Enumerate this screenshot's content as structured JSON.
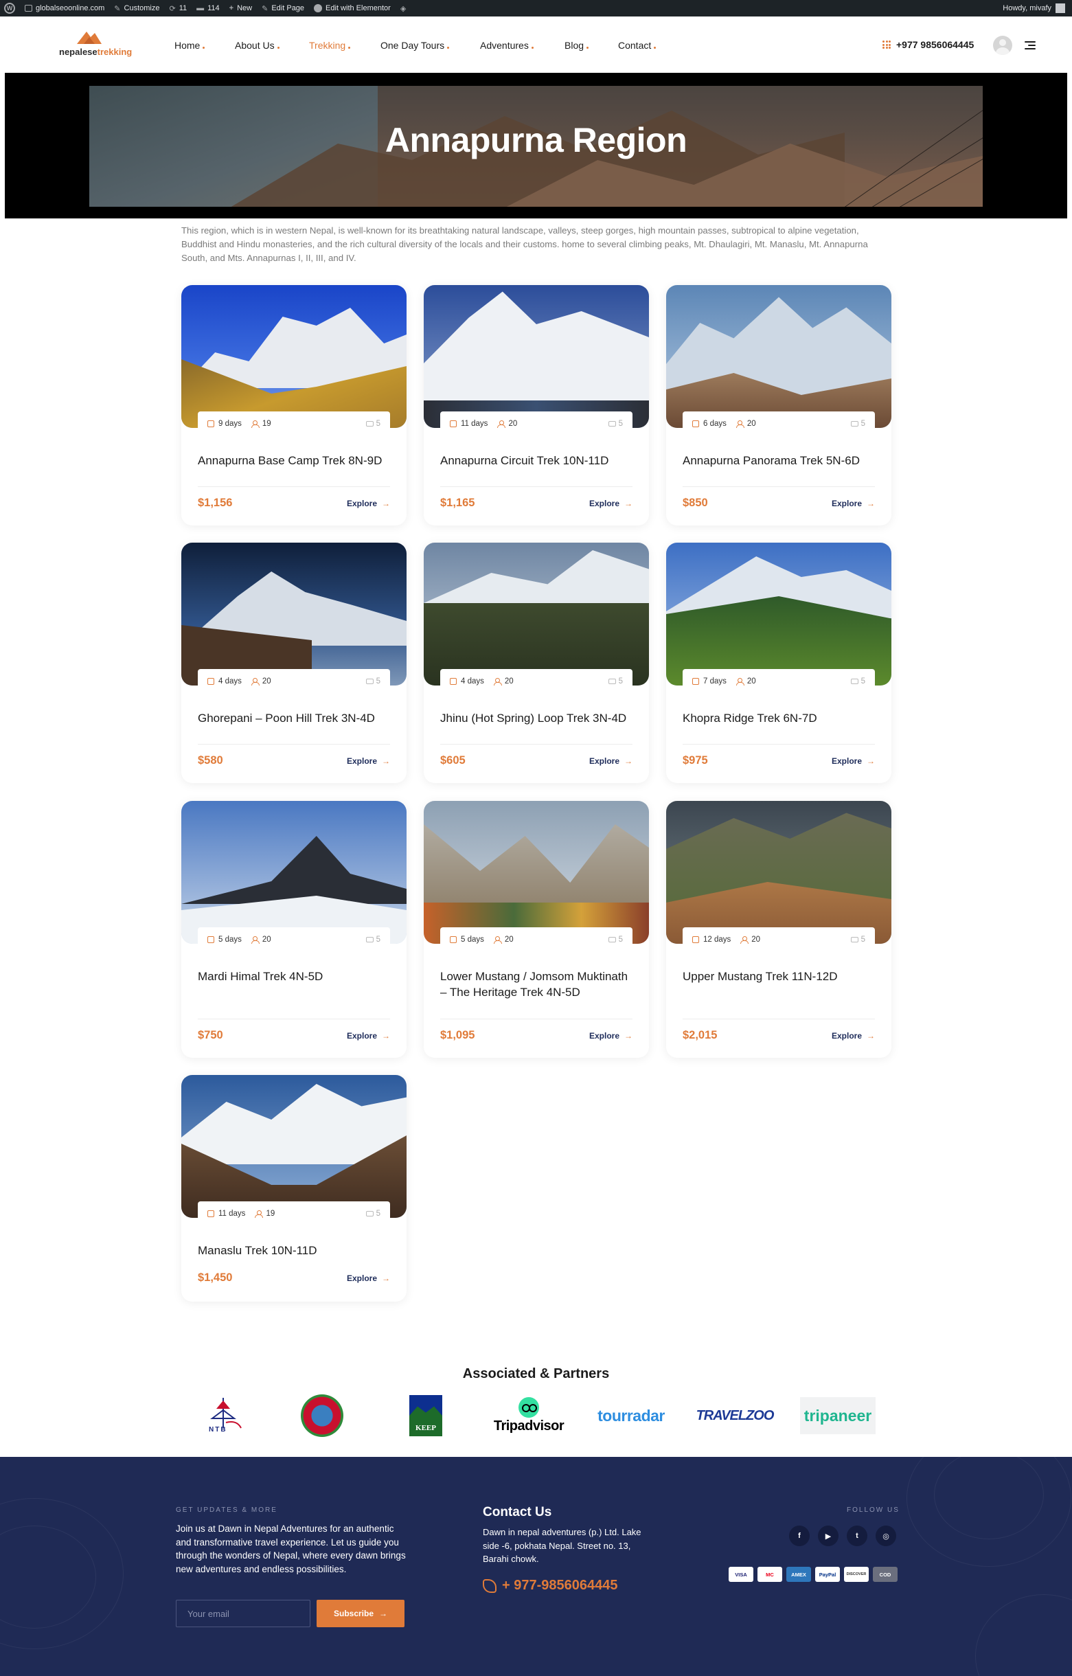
{
  "adminbar": {
    "site": "globalseoonline.com",
    "customize": "Customize",
    "updates": "11",
    "comments": "114",
    "new": "New",
    "edit_page": "Edit Page",
    "elementor": "Edit with Elementor",
    "greeting": "Howdy, mivafy"
  },
  "header": {
    "logo_part1": "nepalese",
    "logo_part2": "trekking",
    "nav": [
      {
        "label": "Home"
      },
      {
        "label": "About Us"
      },
      {
        "label": "Trekking",
        "active": true
      },
      {
        "label": "One Day Tours"
      },
      {
        "label": "Adventures"
      },
      {
        "label": "Blog"
      },
      {
        "label": "Contact"
      }
    ],
    "phone": "+977 9856064445"
  },
  "hero": {
    "title": "Annapurna Region"
  },
  "intro": "This region, which is in western Nepal, is well-known for its breathtaking natural landscape, valleys, steep gorges, high mountain passes, subtropical to alpine vegetation, Buddhist and Hindu monasteries, and the rich cultural diversity of the locals and their customs. home to several climbing peaks, Mt. Dhaulagiri, Mt. Manaslu, Mt. Annapurna South, and Mts. Annapurnas I, II, III, and IV.",
  "explore_label": "Explore",
  "explore_arrow": "→",
  "tours": [
    {
      "days": "9 days",
      "group": "19",
      "photos": "5",
      "title": "Annapurna Base Camp Trek 8N-9D",
      "price": "$1,156"
    },
    {
      "days": "11 days",
      "group": "20",
      "photos": "5",
      "title": "Annapurna Circuit Trek 10N-11D",
      "price": "$1,165"
    },
    {
      "days": "6 days",
      "group": "20",
      "photos": "5",
      "title": "Annapurna Panorama Trek 5N-6D",
      "price": "$850"
    },
    {
      "days": "4 days",
      "group": "20",
      "photos": "5",
      "title": "Ghorepani – Poon Hill Trek 3N-4D",
      "price": "$580"
    },
    {
      "days": "4 days",
      "group": "20",
      "photos": "5",
      "title": "Jhinu (Hot Spring) Loop Trek 3N-4D",
      "price": "$605"
    },
    {
      "days": "7 days",
      "group": "20",
      "photos": "5",
      "title": "Khopra Ridge Trek 6N-7D",
      "price": "$975"
    },
    {
      "days": "5 days",
      "group": "20",
      "photos": "5",
      "title": "Mardi Himal Trek 4N-5D",
      "price": "$750"
    },
    {
      "days": "5 days",
      "group": "20",
      "photos": "5",
      "title": "Lower Mustang / Jomsom Muktinath – The Heritage Trek 4N-5D",
      "price": "$1,095"
    },
    {
      "days": "12 days",
      "group": "20",
      "photos": "5",
      "title": "Upper Mustang Trek 11N-12D",
      "price": "$2,015"
    },
    {
      "days": "11 days",
      "group": "19",
      "photos": "5",
      "title": "Manaslu Trek 10N-11D",
      "price": "$1,450"
    }
  ],
  "partners": {
    "title": "Associated & Partners",
    "ntb": "NTB",
    "keep": "KEEP",
    "tripadvisor": "Tripadvisor",
    "tourradar": "tourradar",
    "travelzoo": "TRAVELZOO",
    "tripaneer": "tripaneer"
  },
  "footer": {
    "kicker": "GET UPDATES & MORE",
    "text": "Join us at Dawn in Nepal Adventures for an authentic and transformative travel experience. Let us guide you through the wonders of Nepal, where every dawn brings new adventures and endless possibilities.",
    "email_placeholder": "Your email",
    "subscribe": "Subscribe",
    "subscribe_arrow": "→",
    "contact_title": "Contact Us",
    "address": "Dawn in nepal adventures (p.) Ltd. Lake side -6, pokhata Nepal. Street no. 13, Barahi chowk.",
    "phone": "+ 977-9856064445",
    "follow": "FOLLOW US",
    "social": [
      "f",
      "▶",
      "t",
      "◎"
    ],
    "payments": [
      "VISA",
      "MC",
      "AMEX",
      "PayPal",
      "DISCOVER",
      "COD"
    ]
  }
}
